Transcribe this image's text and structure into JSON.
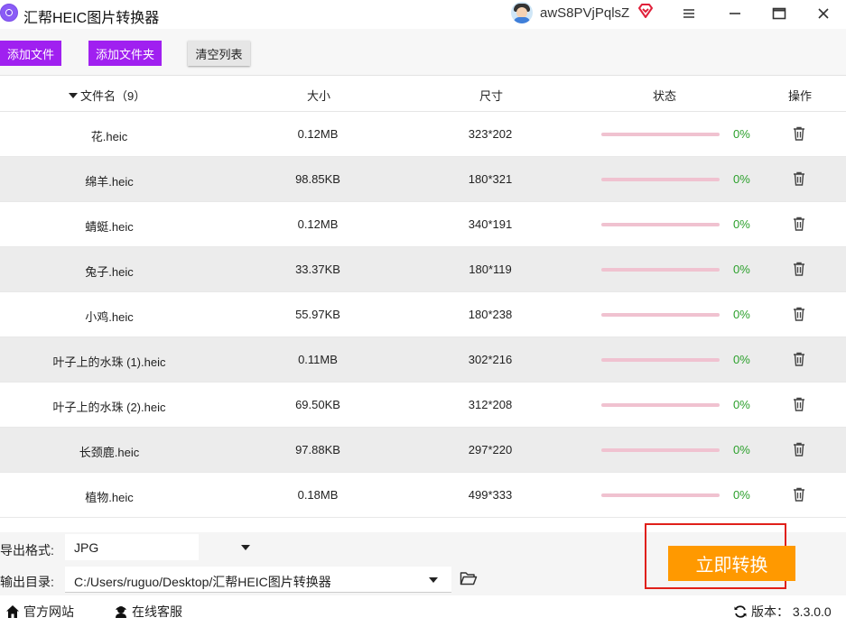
{
  "titlebar": {
    "title": "汇帮HEIC图片转换器",
    "username": "awS8PVjPqlsZ"
  },
  "toolbar": {
    "add_file": "添加文件",
    "add_folder": "添加文件夹",
    "clear_list": "清空列表"
  },
  "table": {
    "headers": {
      "name": "文件名（9）",
      "size": "大小",
      "dimensions": "尺寸",
      "status": "状态",
      "actions": "操作"
    },
    "rows": [
      {
        "name": "花.heic",
        "size": "0.12MB",
        "dimensions": "323*202",
        "progress": 0,
        "status": "0%"
      },
      {
        "name": "绵羊.heic",
        "size": "98.85KB",
        "dimensions": "180*321",
        "progress": 0,
        "status": "0%"
      },
      {
        "name": "蜻蜓.heic",
        "size": "0.12MB",
        "dimensions": "340*191",
        "progress": 0,
        "status": "0%"
      },
      {
        "name": "兔子.heic",
        "size": "33.37KB",
        "dimensions": "180*119",
        "progress": 0,
        "status": "0%"
      },
      {
        "name": "小鸡.heic",
        "size": "55.97KB",
        "dimensions": "180*238",
        "progress": 0,
        "status": "0%"
      },
      {
        "name": "叶子上的水珠 (1).heic",
        "size": "0.11MB",
        "dimensions": "302*216",
        "progress": 0,
        "status": "0%"
      },
      {
        "name": "叶子上的水珠 (2).heic",
        "size": "69.50KB",
        "dimensions": "312*208",
        "progress": 0,
        "status": "0%"
      },
      {
        "name": "长颈鹿.heic",
        "size": "97.88KB",
        "dimensions": "297*220",
        "progress": 0,
        "status": "0%"
      },
      {
        "name": "植物.heic",
        "size": "0.18MB",
        "dimensions": "499*333",
        "progress": 0,
        "status": "0%"
      }
    ]
  },
  "options": {
    "format_label": "导出格式:",
    "format_value": "JPG",
    "dir_label": "输出目录:",
    "dir_value": "C:/Users/ruguo/Desktop/汇帮HEIC图片转换器"
  },
  "convert_button": "立即转换",
  "footer": {
    "website": "官方网站",
    "service": "在线客服",
    "version": "版本：  3.3.0.0"
  },
  "colors": {
    "accent_purple": "#a020f0",
    "convert_orange": "#ff9900",
    "progress_pink": "#f0c2d0",
    "status_green": "#2ca02c",
    "highlight_red": "#e0201a"
  }
}
